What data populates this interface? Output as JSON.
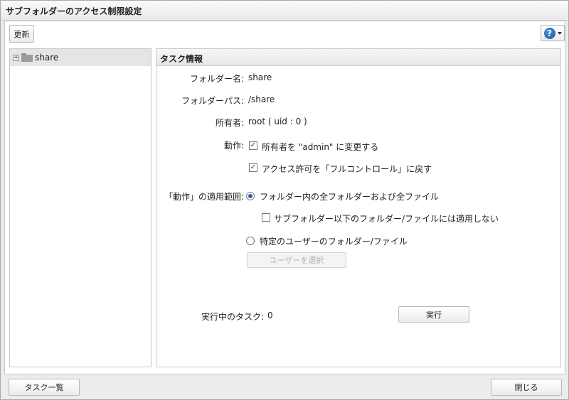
{
  "window": {
    "title": "サブフォルダーのアクセス制限設定"
  },
  "toolbar": {
    "refresh_label": "更新",
    "help_label": "?"
  },
  "tree": {
    "items": [
      {
        "label": "share",
        "expander": "+"
      }
    ]
  },
  "info": {
    "header": "タスク情報",
    "folder_name_label": "フォルダー名:",
    "folder_name_value": "share",
    "folder_path_label": "フォルダーパス:",
    "folder_path_value": "/share",
    "owner_label": "所有者:",
    "owner_value": "root ( uid : 0 )",
    "action_label": "動作:",
    "action_option1": "所有者を \"admin\" に変更する",
    "action_option1_checked": true,
    "action_option2": "アクセス許可を「フルコントロール」に戻す",
    "action_option2_checked": true,
    "scope_label": "「動作」の適用範囲:",
    "scope_option1": "フォルダー内の全フォルダーおよび全ファイル",
    "scope_option1_selected": true,
    "scope_sub_option": "サブフォルダー以下のフォルダー/ファイルには適用しない",
    "scope_sub_option_checked": false,
    "scope_option2": "特定のユーザーのフォルダー/ファイル",
    "scope_option2_selected": false,
    "select_user_label": "ユーザーを選択",
    "running_tasks_label": "実行中のタスク:",
    "running_tasks_value": "0",
    "execute_label": "実行"
  },
  "footer": {
    "task_list_label": "タスク一覧",
    "close_label": "閉じる"
  },
  "colors": {
    "accent": "#2b5fa8",
    "help_icon": "#1f6fc5"
  },
  "icons": {
    "tree_item": "folder-icon",
    "help": "help-icon"
  }
}
